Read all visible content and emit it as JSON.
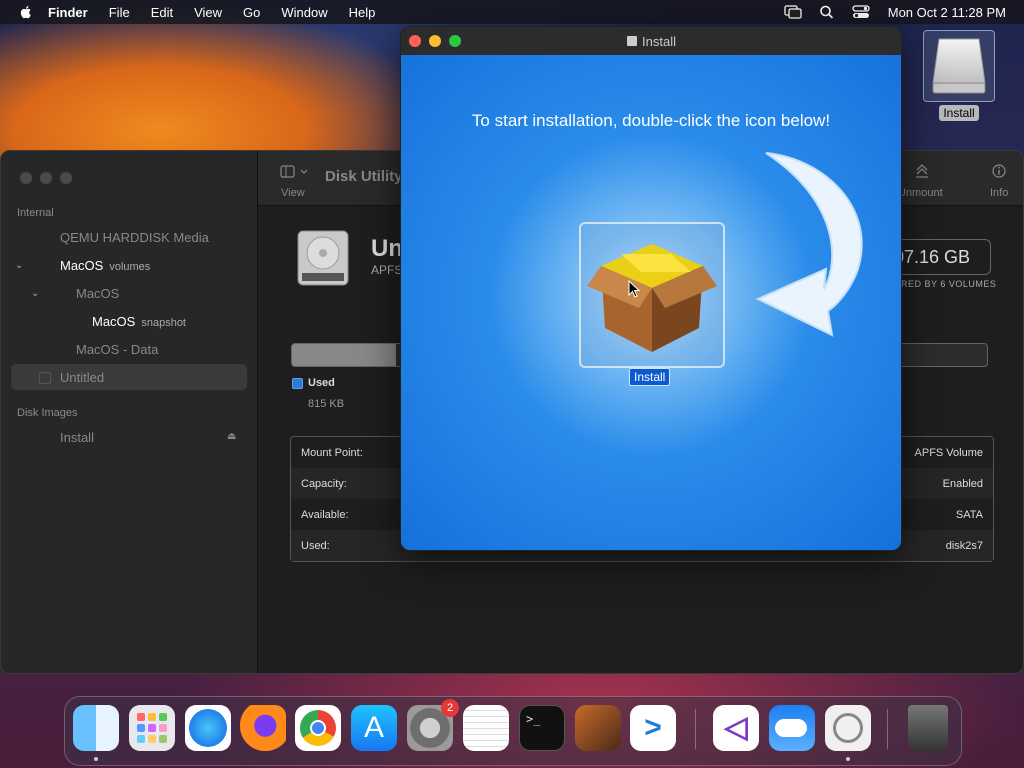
{
  "menubar": {
    "app_name": "Finder",
    "items": [
      "File",
      "Edit",
      "View",
      "Go",
      "Window",
      "Help"
    ],
    "clock": "Mon Oct 2  11:28 PM"
  },
  "desktop": {
    "icon_label": "Install"
  },
  "disk_utility": {
    "title": "Disk Utility",
    "toolbar": {
      "view_label": "View",
      "unmount_label": "Unmount",
      "info_label": "Info"
    },
    "sidebar": {
      "section_internal": "Internal",
      "items": [
        {
          "label": "QEMU HARDDISK Media",
          "sub": ""
        },
        {
          "label": "MacOS",
          "sub": "volumes"
        },
        {
          "label": "MacOS",
          "sub": ""
        },
        {
          "label": "MacOS",
          "sub": "snapshot"
        },
        {
          "label": "MacOS - Data",
          "sub": ""
        },
        {
          "label": "Untitled",
          "sub": ""
        }
      ],
      "section_images": "Disk Images",
      "image_items": [
        {
          "label": "Install"
        }
      ]
    },
    "volume": {
      "name": "Un",
      "subtitle": "APFS",
      "size": "107.16 GB",
      "shared": "SHARED BY 6 VOLUMES",
      "used_fraction": 0.15
    },
    "legend": {
      "used_label": "Used",
      "used_value": "815 KB"
    },
    "info_rows": [
      {
        "key": "Mount Point:",
        "value": "APFS Volume"
      },
      {
        "key": "Capacity:",
        "value": "Enabled"
      },
      {
        "key": "Available:",
        "value": "SATA"
      },
      {
        "key": "Used:",
        "value": "disk2s7"
      }
    ]
  },
  "installer": {
    "title": "Install",
    "instruction": "To start installation, double-click the icon below!",
    "package_label": "Install"
  },
  "dock": {
    "apps": [
      "finder-icon",
      "launchpad-icon",
      "safari-icon",
      "firefox-icon",
      "chrome-icon",
      "app-store-icon",
      "system-settings-icon",
      "textedit-icon",
      "terminal-icon",
      "garageband-icon",
      "vscode-icon",
      "visual-studio-icon",
      "weather-icon",
      "disk-utility-icon",
      "trash-icon"
    ],
    "settings_badge": "2"
  },
  "colors": {
    "accent": "#1570dc",
    "selection": "#0b5ad0"
  }
}
